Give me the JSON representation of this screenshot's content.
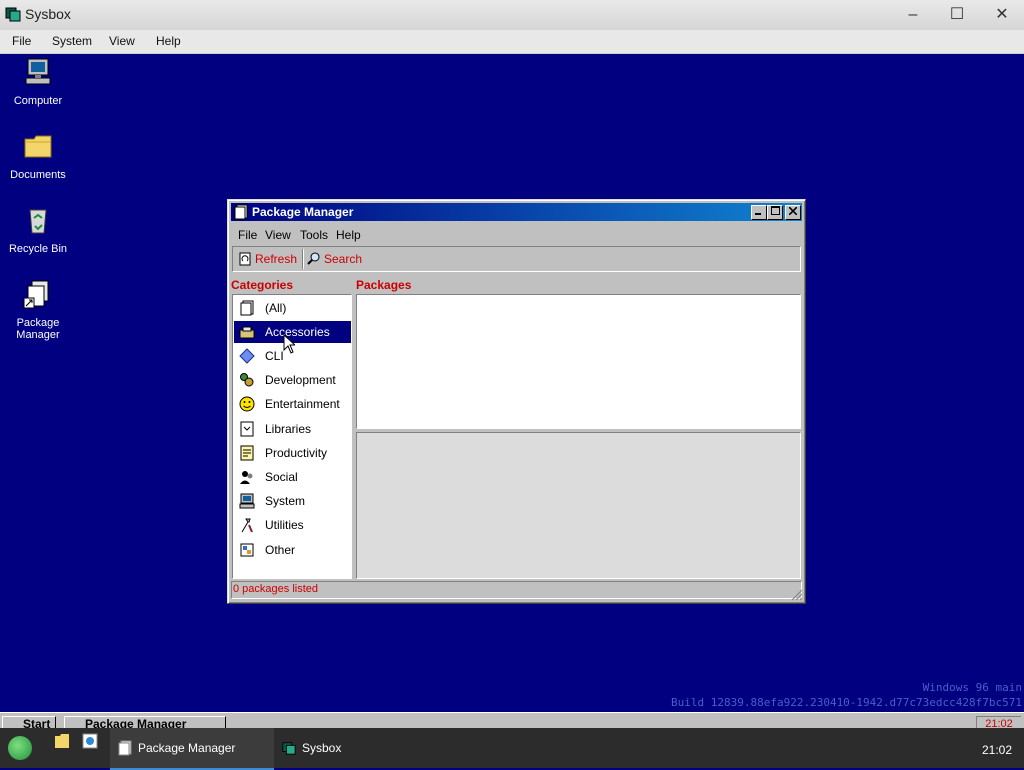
{
  "host_window": {
    "title": "Sysbox",
    "menu": [
      "File",
      "System",
      "View",
      "Help"
    ],
    "controls": {
      "minimize": "–",
      "maximize": "☐",
      "close": "✕"
    }
  },
  "desktop": {
    "icons": [
      {
        "label": "Computer"
      },
      {
        "label": "Documents"
      },
      {
        "label": "Recycle Bin"
      },
      {
        "label": "Package Manager"
      }
    ]
  },
  "package_manager": {
    "title": "Package Manager",
    "menu": [
      "File",
      "View",
      "Tools",
      "Help"
    ],
    "toolbar": {
      "refresh_label": "Refresh",
      "search_label": "Search"
    },
    "categories_heading": "Categories",
    "packages_heading": "Packages",
    "categories": [
      {
        "label": "(All)",
        "icon": "all-icon"
      },
      {
        "label": "Accessories",
        "icon": "accessories-icon",
        "selected": true
      },
      {
        "label": "CLI",
        "icon": "cli-icon"
      },
      {
        "label": "Development",
        "icon": "development-icon"
      },
      {
        "label": "Entertainment",
        "icon": "smiley-icon"
      },
      {
        "label": "Libraries",
        "icon": "libraries-icon"
      },
      {
        "label": "Productivity",
        "icon": "productivity-icon"
      },
      {
        "label": "Social",
        "icon": "social-icon"
      },
      {
        "label": "System",
        "icon": "system-icon"
      },
      {
        "label": "Utilities",
        "icon": "utilities-icon"
      },
      {
        "label": "Other",
        "icon": "other-icon"
      }
    ],
    "status": "0 packages listed"
  },
  "watermark": {
    "line1": "Windows 96 main",
    "line2": "Build 12839.88efa922.230410-1942.d77c73edcc428f7bc571"
  },
  "inner_taskbar": {
    "start_label": "Start",
    "task_label": "Package Manager",
    "clock": "21:02"
  },
  "host_taskbar": {
    "tasks": [
      {
        "label": "Package Manager",
        "active": true
      },
      {
        "label": "Sysbox",
        "active": false
      }
    ],
    "clock": "21:02"
  },
  "colors": {
    "desktop": "#000080",
    "accent_red": "#cc0000",
    "selection": "#000080"
  }
}
